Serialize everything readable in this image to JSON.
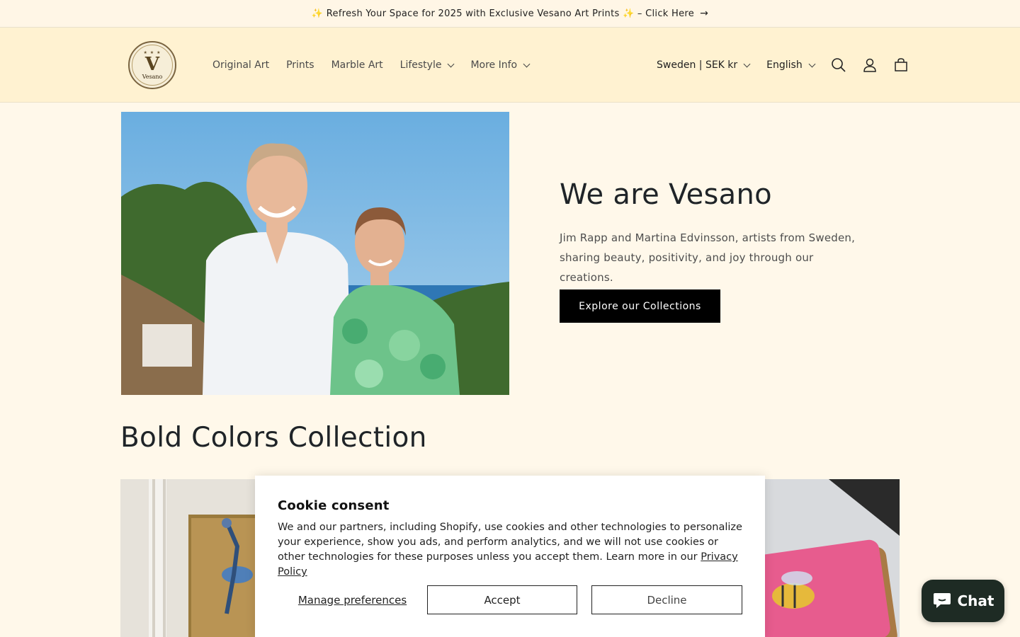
{
  "announcement": {
    "text": "✨ Refresh Your Space for 2025 with Exclusive Vesano Art Prints ✨ – Click Here",
    "arrow": "→"
  },
  "header": {
    "logo": {
      "stars": "★ ★ ★",
      "letter": "V",
      "word": "Vesano"
    },
    "nav": [
      {
        "label": "Original Art",
        "has_dropdown": false
      },
      {
        "label": "Prints",
        "has_dropdown": false
      },
      {
        "label": "Marble Art",
        "has_dropdown": false
      },
      {
        "label": "Lifestyle",
        "has_dropdown": true
      },
      {
        "label": "More Info",
        "has_dropdown": true
      }
    ],
    "country_selector": "Sweden | SEK kr",
    "language_selector": "English",
    "icons": [
      "search-icon",
      "account-icon",
      "cart-icon"
    ]
  },
  "hero": {
    "title": "We are Vesano",
    "text": "Jim Rapp and Martina Edvinsson, artists from Sweden, sharing beauty, positivity, and joy through our creations.",
    "button": "Explore our Collections"
  },
  "collection": {
    "title": "Bold Colors Collection"
  },
  "cookie": {
    "title": "Cookie consent",
    "body": "We and our partners, including Shopify, use cookies and other technologies to personalize your experience, show you ads, and perform analytics, and we will not use cookies or other technologies for these purposes unless you accept them. Learn more in our ",
    "link": "Privacy Policy",
    "manage": "Manage preferences",
    "accept": "Accept",
    "decline": "Decline"
  },
  "chat": {
    "label": "Chat",
    "color": "#1e2b24"
  },
  "colors": {
    "background": "#fff8ea",
    "header_bg": "#fff2d1",
    "button_bg": "#000000"
  }
}
